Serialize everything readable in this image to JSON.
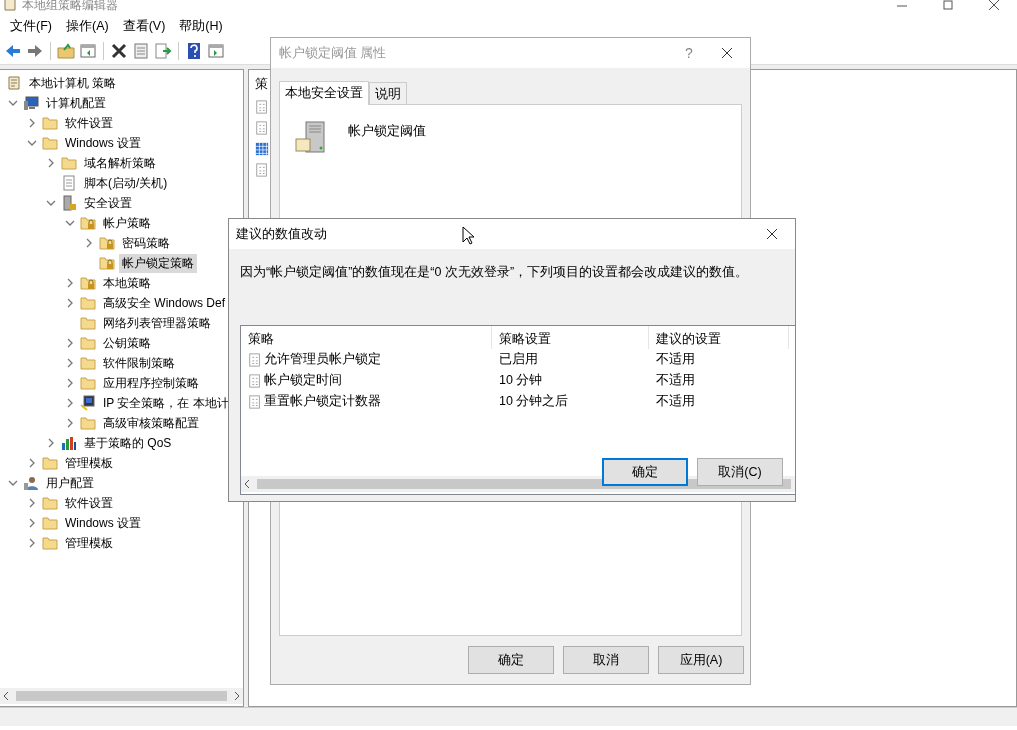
{
  "window": {
    "title": "本地组策略编辑器"
  },
  "menu": [
    "文件(F)",
    "操作(A)",
    "查看(V)",
    "帮助(H)"
  ],
  "toolbar": [
    {
      "kind": "back"
    },
    {
      "kind": "forward"
    },
    {
      "kind": "sep"
    },
    {
      "kind": "up"
    },
    {
      "kind": "pane"
    },
    {
      "kind": "sep"
    },
    {
      "kind": "delete"
    },
    {
      "kind": "props"
    },
    {
      "kind": "export"
    },
    {
      "kind": "sep"
    },
    {
      "kind": "help"
    },
    {
      "kind": "panel"
    }
  ],
  "tree": {
    "root": {
      "label": "本地计算机 策略",
      "kind": "scroll"
    },
    "items": [
      {
        "label": "计算机配置",
        "kind": "computer",
        "expanded": true,
        "selected": false,
        "children": [
          {
            "label": "软件设置",
            "kind": "folder",
            "expanded": false,
            "selected": false
          },
          {
            "label": "Windows 设置",
            "kind": "folder",
            "expanded": true,
            "selected": false,
            "children": [
              {
                "label": "域名解析策略",
                "kind": "folder",
                "expanded": false,
                "selected": false
              },
              {
                "label": "脚本(启动/关机)",
                "kind": "script",
                "selected": false
              },
              {
                "label": "安全设置",
                "kind": "security",
                "expanded": true,
                "selected": false,
                "children": [
                  {
                    "label": "帐户策略",
                    "kind": "lockfolder",
                    "expanded": true,
                    "selected": false,
                    "children": [
                      {
                        "label": "密码策略",
                        "kind": "lockfolder",
                        "expanded": false,
                        "selected": false
                      },
                      {
                        "label": "帐户锁定策略",
                        "kind": "lockfolder",
                        "selected": true
                      }
                    ]
                  },
                  {
                    "label": "本地策略",
                    "kind": "lockfolder",
                    "expanded": false,
                    "selected": false
                  },
                  {
                    "label": "高级安全 Windows Def",
                    "kind": "folder",
                    "expanded": false,
                    "selected": false
                  },
                  {
                    "label": "网络列表管理器策略",
                    "kind": "folder",
                    "selected": false
                  },
                  {
                    "label": "公钥策略",
                    "kind": "folder",
                    "expanded": false,
                    "selected": false
                  },
                  {
                    "label": "软件限制策略",
                    "kind": "folder",
                    "expanded": false,
                    "selected": false
                  },
                  {
                    "label": "应用程序控制策略",
                    "kind": "folder",
                    "expanded": false,
                    "selected": false
                  },
                  {
                    "label": "IP 安全策略，在 本地计",
                    "kind": "ip",
                    "expanded": false,
                    "selected": false
                  },
                  {
                    "label": "高级审核策略配置",
                    "kind": "folder",
                    "expanded": false,
                    "selected": false
                  }
                ]
              },
              {
                "label": "基于策略的 QoS",
                "kind": "qos",
                "expanded": false,
                "selected": false
              }
            ]
          },
          {
            "label": "管理模板",
            "kind": "folder",
            "expanded": false,
            "selected": false
          }
        ]
      },
      {
        "label": "用户配置",
        "kind": "user",
        "expanded": true,
        "selected": false,
        "children": [
          {
            "label": "软件设置",
            "kind": "folder",
            "expanded": false,
            "selected": false
          },
          {
            "label": "Windows 设置",
            "kind": "folder",
            "expanded": false,
            "selected": false
          },
          {
            "label": "管理模板",
            "kind": "folder",
            "expanded": false,
            "selected": false
          }
        ]
      }
    ]
  },
  "right_pane": {
    "column_header": "策",
    "rows": [
      {
        "selected": false
      },
      {
        "selected": false
      },
      {
        "selected": true
      },
      {
        "selected": false
      }
    ]
  },
  "properties_dialog": {
    "title": "帐户锁定阈值 属性",
    "help": "?",
    "tabs": [
      {
        "label": "本地安全设置",
        "selected": true
      },
      {
        "label": "说明",
        "selected": false
      }
    ],
    "setting_name": "帐户锁定阈值",
    "buttons": [
      "确定",
      "取消",
      "应用(A)"
    ]
  },
  "change_dialog": {
    "title": "建议的数值改动",
    "message": "因为“帐户锁定阈值”的数值现在是“0 次无效登录”，下列项目的设置都会改成建议的数值。",
    "columns": [
      "策略",
      "策略设置",
      "建议的设置"
    ],
    "rows": [
      [
        "允许管理员帐户锁定",
        "已启用",
        "不适用"
      ],
      [
        "帐户锁定时间",
        "10 分钟",
        "不适用"
      ],
      [
        "重置帐户锁定计数器",
        "10 分钟之后",
        "不适用"
      ]
    ],
    "buttons": [
      {
        "label": "确定",
        "default": true
      },
      {
        "label": "取消(C)",
        "default": false
      }
    ]
  }
}
